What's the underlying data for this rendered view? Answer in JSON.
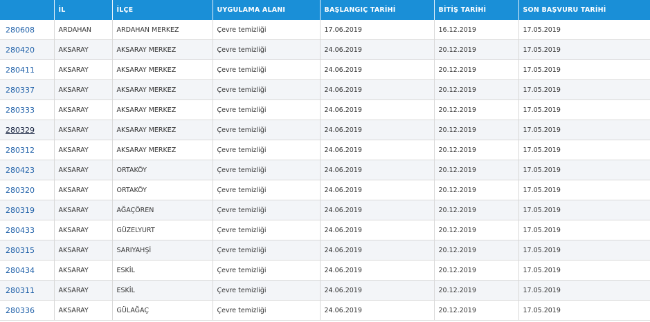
{
  "table": {
    "headers": [
      "",
      "İL",
      "İLÇE",
      "UYGULAMA ALANI",
      "BAŞLANGIÇ TARİHİ",
      "BİTİŞ TARİHİ",
      "SON BAŞVURU TARİHİ"
    ],
    "rows": [
      {
        "id": "280608",
        "il": "ARDAHAN",
        "ilce": "ARDAHAN MERKEZ",
        "alan": "Çevre temizliği",
        "baslangic": "17.06.2019",
        "bitis": "16.12.2019",
        "son_basvuru": "17.05.2019"
      },
      {
        "id": "280420",
        "il": "AKSARAY",
        "ilce": "AKSARAY MERKEZ",
        "alan": "Çevre temizliği",
        "baslangic": "24.06.2019",
        "bitis": "20.12.2019",
        "son_basvuru": "17.05.2019"
      },
      {
        "id": "280411",
        "il": "AKSARAY",
        "ilce": "AKSARAY MERKEZ",
        "alan": "Çevre temizliği",
        "baslangic": "24.06.2019",
        "bitis": "20.12.2019",
        "son_basvuru": "17.05.2019"
      },
      {
        "id": "280337",
        "il": "AKSARAY",
        "ilce": "AKSARAY MERKEZ",
        "alan": "Çevre temizliği",
        "baslangic": "24.06.2019",
        "bitis": "20.12.2019",
        "son_basvuru": "17.05.2019"
      },
      {
        "id": "280333",
        "il": "AKSARAY",
        "ilce": "AKSARAY MERKEZ",
        "alan": "Çevre temizliği",
        "baslangic": "24.06.2019",
        "bitis": "20.12.2019",
        "son_basvuru": "17.05.2019"
      },
      {
        "id": "280329",
        "il": "AKSARAY",
        "ilce": "AKSARAY MERKEZ",
        "alan": "Çevre temizliği",
        "baslangic": "24.06.2019",
        "bitis": "20.12.2019",
        "son_basvuru": "17.05.2019"
      },
      {
        "id": "280312",
        "il": "AKSARAY",
        "ilce": "AKSARAY MERKEZ",
        "alan": "Çevre temizliği",
        "baslangic": "24.06.2019",
        "bitis": "20.12.2019",
        "son_basvuru": "17.05.2019"
      },
      {
        "id": "280423",
        "il": "AKSARAY",
        "ilce": "ORTAKÖY",
        "alan": "Çevre temizliği",
        "baslangic": "24.06.2019",
        "bitis": "20.12.2019",
        "son_basvuru": "17.05.2019"
      },
      {
        "id": "280320",
        "il": "AKSARAY",
        "ilce": "ORTAKÖY",
        "alan": "Çevre temizliği",
        "baslangic": "24.06.2019",
        "bitis": "20.12.2019",
        "son_basvuru": "17.05.2019"
      },
      {
        "id": "280319",
        "il": "AKSARAY",
        "ilce": "AĞAÇÖREN",
        "alan": "Çevre temizliği",
        "baslangic": "24.06.2019",
        "bitis": "20.12.2019",
        "son_basvuru": "17.05.2019"
      },
      {
        "id": "280433",
        "il": "AKSARAY",
        "ilce": "GÜZELYURT",
        "alan": "Çevre temizliği",
        "baslangic": "24.06.2019",
        "bitis": "20.12.2019",
        "son_basvuru": "17.05.2019"
      },
      {
        "id": "280315",
        "il": "AKSARAY",
        "ilce": "SARIYAHŞİ",
        "alan": "Çevre temizliği",
        "baslangic": "24.06.2019",
        "bitis": "20.12.2019",
        "son_basvuru": "17.05.2019"
      },
      {
        "id": "280434",
        "il": "AKSARAY",
        "ilce": "ESKİL",
        "alan": "Çevre temizliği",
        "baslangic": "24.06.2019",
        "bitis": "20.12.2019",
        "son_basvuru": "17.05.2019"
      },
      {
        "id": "280311",
        "il": "AKSARAY",
        "ilce": "ESKİL",
        "alan": "Çevre temizliği",
        "baslangic": "24.06.2019",
        "bitis": "20.12.2019",
        "son_basvuru": "17.05.2019"
      },
      {
        "id": "280336",
        "il": "AKSARAY",
        "ilce": "GÜLAĞAÇ",
        "alan": "Çevre temizliği",
        "baslangic": "24.06.2019",
        "bitis": "20.12.2019",
        "son_basvuru": "17.05.2019"
      }
    ],
    "visited_ids": [
      "280329"
    ]
  },
  "colors": {
    "header_bg": "#1a8fd7",
    "header_text": "#ffffff",
    "link": "#1d5fa8",
    "link_visited": "#111d3a"
  }
}
